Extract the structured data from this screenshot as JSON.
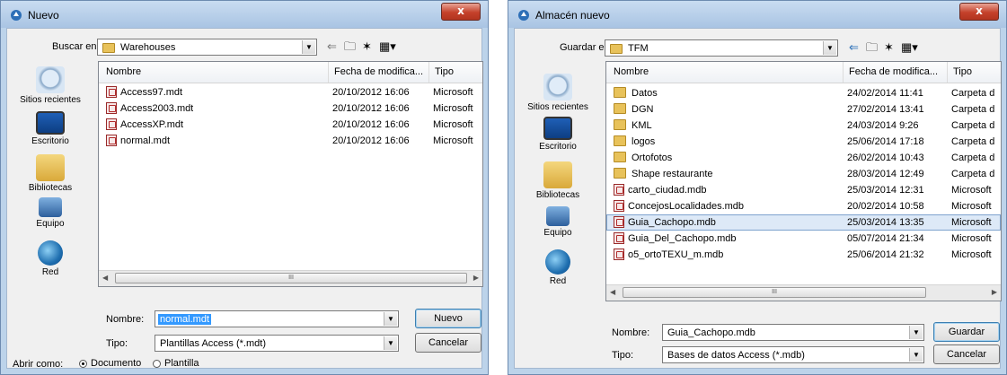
{
  "left": {
    "title": "Nuevo",
    "look_in_label": "Buscar en:",
    "look_in_value": "Warehouses",
    "places": [
      "Sitios recientes",
      "Escritorio",
      "Bibliotecas",
      "Equipo",
      "Red"
    ],
    "columns": [
      "Nombre",
      "Fecha de modifica...",
      "Tipo"
    ],
    "files": [
      {
        "name": "Access97.mdt",
        "date": "20/10/2012 16:06",
        "type": "Microsoft"
      },
      {
        "name": "Access2003.mdt",
        "date": "20/10/2012 16:06",
        "type": "Microsoft"
      },
      {
        "name": "AccessXP.mdt",
        "date": "20/10/2012 16:06",
        "type": "Microsoft"
      },
      {
        "name": "normal.mdt",
        "date": "20/10/2012 16:06",
        "type": "Microsoft"
      }
    ],
    "name_label": "Nombre:",
    "name_value": "normal.mdt",
    "type_label": "Tipo:",
    "type_value": "Plantillas Access (*.mdt)",
    "ok_button": "Nuevo",
    "cancel_button": "Cancelar",
    "open_as_label": "Abrir como:",
    "option_document": "Documento",
    "option_template": "Plantilla",
    "scroll_thumb": "III"
  },
  "right": {
    "title": "Almacén nuevo",
    "save_in_label": "Guardar en:",
    "save_in_value": "TFM",
    "places": [
      "Sitios recientes",
      "Escritorio",
      "Bibliotecas",
      "Equipo",
      "Red"
    ],
    "columns": [
      "Nombre",
      "Fecha de modifica...",
      "Tipo"
    ],
    "files": [
      {
        "name": "Datos",
        "date": "24/02/2014 11:41",
        "type": "Carpeta d",
        "kind": "folder"
      },
      {
        "name": "DGN",
        "date": "27/02/2014 13:41",
        "type": "Carpeta d",
        "kind": "folder"
      },
      {
        "name": "KML",
        "date": "24/03/2014 9:26",
        "type": "Carpeta d",
        "kind": "folder"
      },
      {
        "name": "logos",
        "date": "25/06/2014 17:18",
        "type": "Carpeta d",
        "kind": "folder"
      },
      {
        "name": "Ortofotos",
        "date": "26/02/2014 10:43",
        "type": "Carpeta d",
        "kind": "folder"
      },
      {
        "name": "Shape restaurante",
        "date": "28/03/2014 12:49",
        "type": "Carpeta d",
        "kind": "folder"
      },
      {
        "name": "carto_ciudad.mdb",
        "date": "25/03/2014 12:31",
        "type": "Microsoft",
        "kind": "file"
      },
      {
        "name": "ConcejosLocalidades.mdb",
        "date": "20/02/2014 10:58",
        "type": "Microsoft",
        "kind": "file"
      },
      {
        "name": "Guia_Cachopo.mdb",
        "date": "25/03/2014 13:35",
        "type": "Microsoft",
        "kind": "file",
        "selected": true
      },
      {
        "name": "Guia_Del_Cachopo.mdb",
        "date": "05/07/2014 21:34",
        "type": "Microsoft",
        "kind": "file"
      },
      {
        "name": "o5_ortoTEXU_m.mdb",
        "date": "25/06/2014 21:32",
        "type": "Microsoft",
        "kind": "file"
      }
    ],
    "name_label": "Nombre:",
    "name_value": "Guia_Cachopo.mdb",
    "type_label": "Tipo:",
    "type_value": "Bases de datos Access (*.mdb)",
    "save_button": "Guardar",
    "cancel_button": "Cancelar",
    "scroll_thumb": "III"
  }
}
